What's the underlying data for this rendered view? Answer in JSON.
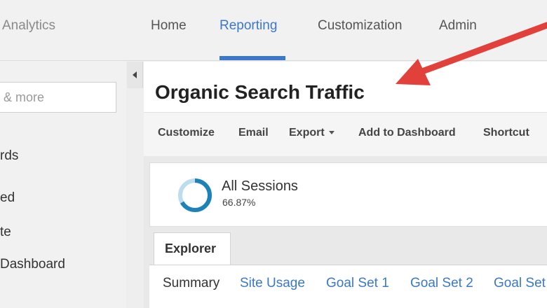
{
  "header": {
    "app_name": "Analytics",
    "nav": [
      {
        "label": "Home",
        "active": false
      },
      {
        "label": "Reporting",
        "active": true
      },
      {
        "label": "Customization",
        "active": false
      },
      {
        "label": "Admin",
        "active": false
      }
    ]
  },
  "sidebar": {
    "search_placeholder": "& more",
    "items": [
      {
        "label": "rds"
      },
      {
        "label": "ed"
      },
      {
        "label": "te"
      },
      {
        "label": "Dashboard"
      }
    ],
    "collapse_icon": "chevron-left-icon"
  },
  "main": {
    "title": "Organic Search Traffic",
    "toolbar": {
      "customize": "Customize",
      "email": "Email",
      "export": "Export",
      "add_to_dashboard": "Add to Dashboard",
      "shortcut": "Shortcut"
    },
    "segment": {
      "name": "All Sessions",
      "percent_label": "66.87%",
      "percent_value": 66.87
    },
    "explorer_tab": "Explorer",
    "subtabs": [
      {
        "label": "Summary",
        "active": true
      },
      {
        "label": "Site Usage",
        "active": false
      },
      {
        "label": "Goal Set 1",
        "active": false
      },
      {
        "label": "Goal Set 2",
        "active": false
      },
      {
        "label": "Goal Set",
        "active": false
      }
    ]
  },
  "colors": {
    "accent": "#3b78c7",
    "ring": "#1d82b8",
    "ring_track": "#bcdcf0",
    "arrow": "#e2403b"
  }
}
